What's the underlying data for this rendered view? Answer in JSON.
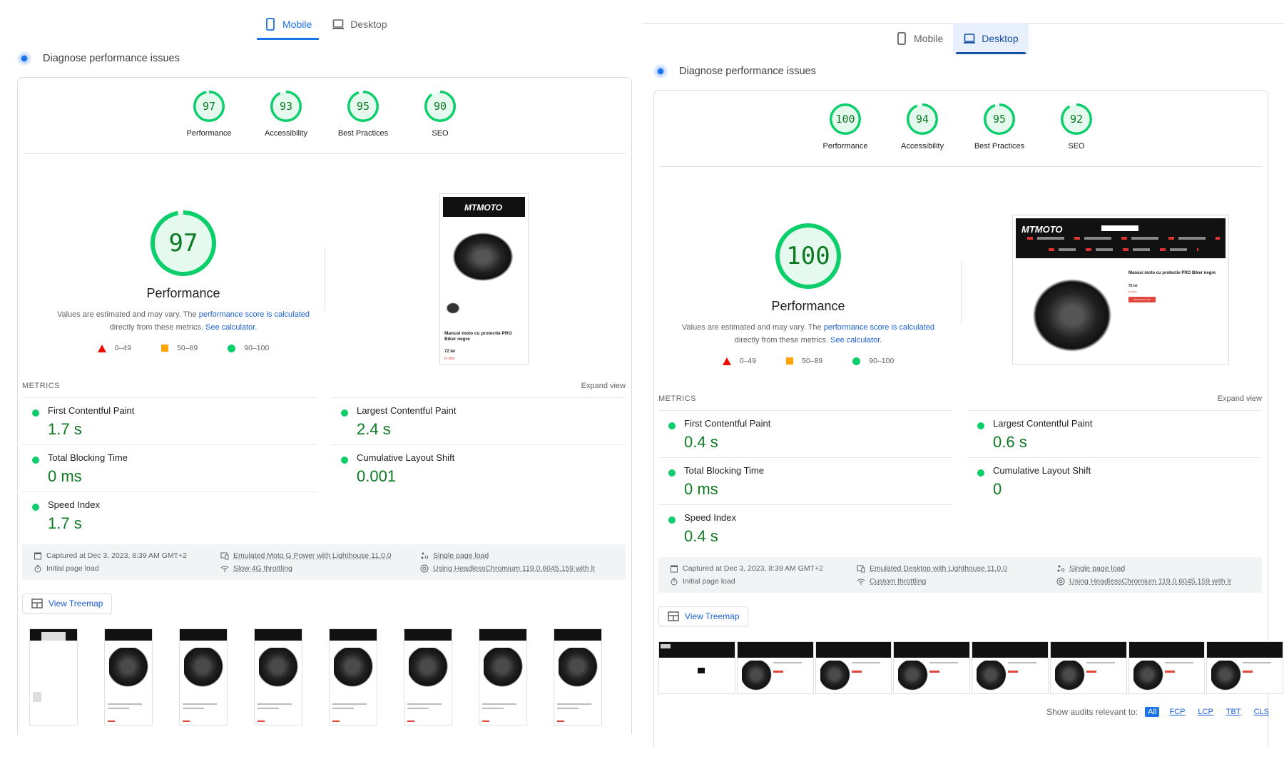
{
  "colors": {
    "pass": "#0cce6b",
    "pass_text": "#0d7a22",
    "average": "#ffa400",
    "fail": "#eb0f00",
    "link": "#1a5fd4",
    "accent": "#1a73e8"
  },
  "tabs": {
    "mobile": "Mobile",
    "desktop": "Desktop"
  },
  "diagnose_title": "Diagnose performance issues",
  "gauge_labels": {
    "performance": "Performance",
    "accessibility": "Accessibility",
    "best_practices": "Best Practices",
    "seo": "SEO"
  },
  "note": {
    "prefix": "Values are estimated and may vary. The ",
    "link1": "performance score is calculated",
    "middle": " directly from these metrics. ",
    "link2": "See calculator."
  },
  "legend": {
    "fail": "0–49",
    "average": "50–89",
    "pass": "90–100"
  },
  "metrics_heading": "METRICS",
  "expand_view": "Expand view",
  "metric_names": {
    "fcp": "First Contentful Paint",
    "lcp": "Largest Contentful Paint",
    "tbt": "Total Blocking Time",
    "cls": "Cumulative Layout Shift",
    "si": "Speed Index"
  },
  "view_treemap": "View Treemap",
  "mobile": {
    "active_tab": "mobile",
    "scores": {
      "performance": 97,
      "accessibility": 93,
      "best_practices": 95,
      "seo": 90
    },
    "metrics": {
      "fcp": "1.7 s",
      "lcp": "2.4 s",
      "tbt": "0 ms",
      "cls": "0.001",
      "si": "1.7 s"
    },
    "info": {
      "captured": "Captured at Dec 3, 2023, 8:39 AM GMT+2",
      "emulated": "Emulated Moto G Power with Lighthouse 11.0.0",
      "single": "Single page load",
      "initial": "Initial page load",
      "throttling": "Slow 4G throttling",
      "browser": "Using HeadlessChromium 119.0.6045.159 with lr"
    },
    "screenshot": {
      "logo": "MTMOTO",
      "product_title": "Manusi moto cu protectie PRO Biker negre",
      "price": "72 lei",
      "stock": "In stoc"
    },
    "filmstrip_frames": 8
  },
  "desktop": {
    "active_tab": "desktop",
    "scores": {
      "performance": 100,
      "accessibility": 94,
      "best_practices": 95,
      "seo": 92
    },
    "metrics": {
      "fcp": "0.4 s",
      "lcp": "0.6 s",
      "tbt": "0 ms",
      "cls": "0",
      "si": "0.4 s"
    },
    "info": {
      "captured": "Captured at Dec 3, 2023, 8:39 AM GMT+2",
      "emulated": "Emulated Desktop with Lighthouse 11.0.0",
      "single": "Single page load",
      "initial": "Initial page load",
      "throttling": "Custom throttling",
      "browser": "Using HeadlessChromium 119.0.6045.159 with lr"
    },
    "screenshot": {
      "logo": "MTMOTO",
      "product_title": "Manusi moto cu protectie PRO Biker negre",
      "price": "72 lei",
      "stock": "In stoc",
      "button": "ADAUGA IN COS"
    },
    "filmstrip_frames": 8
  },
  "show_audits": {
    "label": "Show audits relevant to:",
    "chips": [
      "All",
      "FCP",
      "LCP",
      "TBT",
      "CLS"
    ],
    "active": "All"
  }
}
